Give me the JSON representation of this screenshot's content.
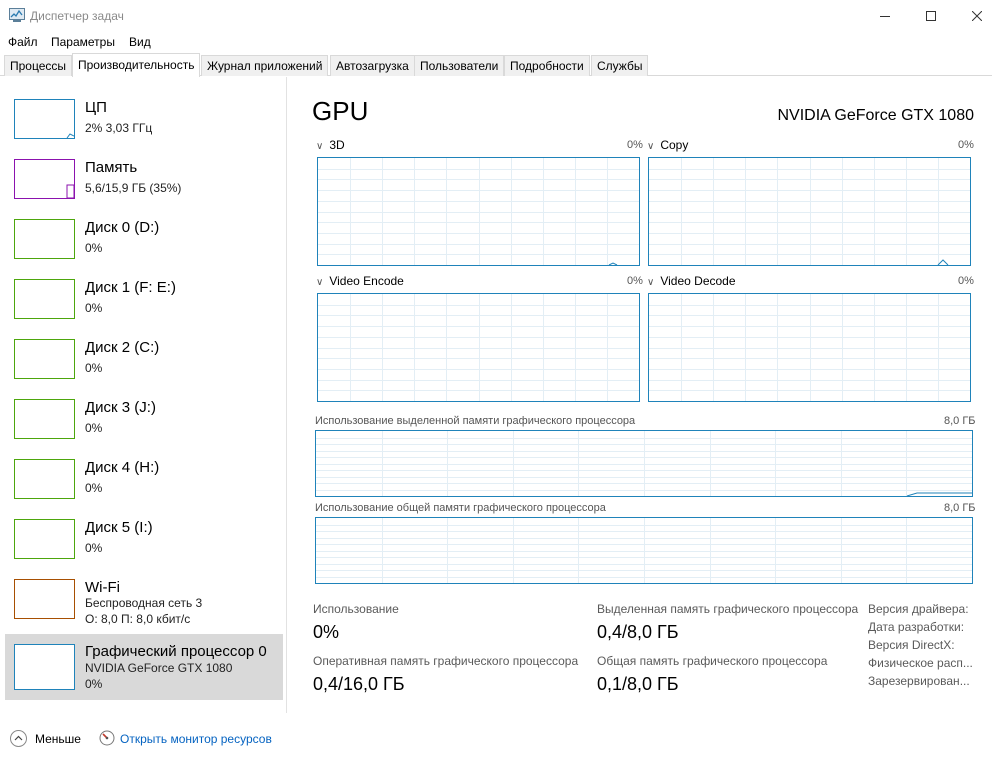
{
  "window": {
    "title": "Диспетчер задач"
  },
  "menu": [
    "Файл",
    "Параметры",
    "Вид"
  ],
  "tabs": [
    {
      "label": "Процессы",
      "active": false
    },
    {
      "label": "Производительность",
      "active": true
    },
    {
      "label": "Журнал приложений",
      "active": false
    },
    {
      "label": "Автозагрузка",
      "active": false
    },
    {
      "label": "Пользователи",
      "active": false
    },
    {
      "label": "Подробности",
      "active": false
    },
    {
      "label": "Службы",
      "active": false
    }
  ],
  "sidebar": {
    "items": [
      {
        "title": "ЦП",
        "sub": "2%  3,03 ГГц",
        "sub2": "",
        "color": "#1f83ba"
      },
      {
        "title": "Память",
        "sub": "5,6/15,9 ГБ (35%)",
        "sub2": "",
        "color": "#8b12ae"
      },
      {
        "title": "Диск 0 (D:)",
        "sub": "0%",
        "sub2": "",
        "color": "#4da60c"
      },
      {
        "title": "Диск 1 (F: E:)",
        "sub": "0%",
        "sub2": "",
        "color": "#4da60c"
      },
      {
        "title": "Диск 2 (C:)",
        "sub": "0%",
        "sub2": "",
        "color": "#4da60c"
      },
      {
        "title": "Диск 3 (J:)",
        "sub": "0%",
        "sub2": "",
        "color": "#4da60c"
      },
      {
        "title": "Диск 4 (H:)",
        "sub": "0%",
        "sub2": "",
        "color": "#4da60c"
      },
      {
        "title": "Диск 5 (I:)",
        "sub": "0%",
        "sub2": "",
        "color": "#4da60c"
      },
      {
        "title": "Wi-Fi",
        "sub": "Беспроводная сеть 3",
        "sub2": "О: 8,0  П: 8,0 кбит/с",
        "color": "#a74f01"
      },
      {
        "title": "Графический процессор 0",
        "sub": "NVIDIA GeForce GTX 1080",
        "sub2": "0%",
        "color": "#1f83ba"
      }
    ]
  },
  "main": {
    "title": "GPU",
    "device": "NVIDIA GeForce GTX 1080",
    "engines": [
      {
        "label": "3D",
        "percent": "0%"
      },
      {
        "label": "Copy",
        "percent": "0%"
      },
      {
        "label": "Video Encode",
        "percent": "0%"
      },
      {
        "label": "Video Decode",
        "percent": "0%"
      }
    ],
    "dedicated": {
      "label": "Использование выделенной памяти графического процессора",
      "max": "8,0 ГБ"
    },
    "shared": {
      "label": "Использование общей памяти графического процессора",
      "max": "8,0 ГБ"
    },
    "stats": {
      "usage_label": "Использование",
      "usage_value": "0%",
      "dedicated_label": "Выделенная память графического процессора",
      "dedicated_value": "0,4/8,0 ГБ",
      "gpu_ram_label": "Оперативная память графического процессора",
      "gpu_ram_value": "0,4/16,0 ГБ",
      "shared_label": "Общая память графического процессора",
      "shared_value": "0,1/8,0 ГБ"
    },
    "info": [
      "Версия драйвера:",
      "Дата разработки:",
      "Версия DirectX:",
      "Физическое расп...",
      "Зарезервирован..."
    ]
  },
  "footer": {
    "fewer_label": "Меньше",
    "monitor_link": "Открыть монитор ресурсов"
  },
  "colors": {
    "gpu_accent": "#1f83ba",
    "memory_accent": "#8b12ae",
    "disk_accent": "#4da60c",
    "wifi_accent": "#a74f01",
    "link": "#0563c1"
  }
}
